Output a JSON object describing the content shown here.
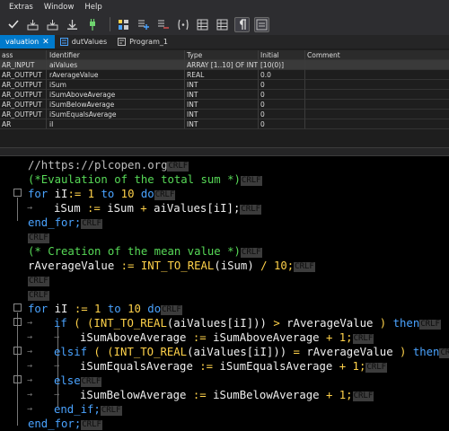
{
  "menu": [
    "Extras",
    "Window",
    "Help"
  ],
  "tabs": [
    {
      "label": "valuation",
      "active": true
    },
    {
      "label": "dutValues",
      "active": false
    },
    {
      "label": "Program_1",
      "active": false
    }
  ],
  "decl_headers": [
    "ass",
    "Identifier",
    "Type",
    "Initial",
    "Comment"
  ],
  "decl_rows": [
    [
      "AR_INPUT",
      "aiValues",
      "ARRAY [1..10] OF INT",
      "[10(0)]",
      ""
    ],
    [
      "AR_OUTPUT",
      "rAverageValue",
      "REAL",
      "0.0",
      ""
    ],
    [
      "AR_OUTPUT",
      "iSum",
      "INT",
      "0",
      ""
    ],
    [
      "AR_OUTPUT",
      "iSumAboveAverage",
      "INT",
      "0",
      ""
    ],
    [
      "AR_OUTPUT",
      "iSumBelowAverage",
      "INT",
      "0",
      ""
    ],
    [
      "AR_OUTPUT",
      "iSumEqualsAverage",
      "INT",
      "0",
      ""
    ],
    [
      "AR",
      "iI",
      "INT",
      "0",
      ""
    ]
  ],
  "code": {
    "l1": "//https://plcopen.org",
    "l2": "(*Evaulation of the total sum *)",
    "l3a": "for",
    "l3b": " iI",
    "l3c": ":=",
    "l3d": " 1",
    "l3e": " to",
    "l3f": " 10",
    "l3g": " do",
    "l4a": "iSum",
    "l4b": " :=",
    "l4c": " iSum",
    "l4d": " +",
    "l4e": " aiValues",
    "l4f": "[iI];",
    "l5": "end_for;",
    "l7": "(* Creation of the mean value *)",
    "l8a": "rAverageValue",
    "l8b": " :=",
    "l8c": " INT_TO_REAL",
    "l8d": "(iSum)",
    "l8e": " /",
    "l8f": " 10;",
    "l11a": "for",
    "l11b": " iI",
    "l11c": " :=",
    "l11d": " 1",
    "l11e": " to",
    "l11f": " 10",
    "l11g": " do",
    "l12a": "if",
    "l12b": " ( (INT_TO_REAL",
    "l12c": "(aiValues[iI]))",
    "l12d": " >",
    "l12e": " rAverageValue",
    "l12f": " )",
    "l12g": " then",
    "l13a": "iSumAboveAverage",
    "l13b": " :=",
    "l13c": " iSumAboveAverage",
    "l13d": " +",
    "l13e": " 1;",
    "l14a": "elsif",
    "l14b": " ( (INT_TO_REAL",
    "l14c": "(aiValues[iI]))",
    "l14d": " =",
    "l14e": " rAverageValue",
    "l14f": " )",
    "l14g": " then",
    "l15a": "iSumEqualsAverage",
    "l15b": " :=",
    "l15c": " iSumEqualsAverage",
    "l15d": " +",
    "l15e": " 1;",
    "l16": "else",
    "l17a": "iSumBelowAverage",
    "l17b": " :=",
    "l17c": " iSumBelowAverage",
    "l17d": " +",
    "l17e": " 1;",
    "l18": "end_if;",
    "l19": "end_for;",
    "crlf": "CRLF"
  },
  "colors": {
    "keyword": "#4aa3ff",
    "comment": "#57d957",
    "number": "#ffd24a",
    "active_tab": "#007acc"
  }
}
